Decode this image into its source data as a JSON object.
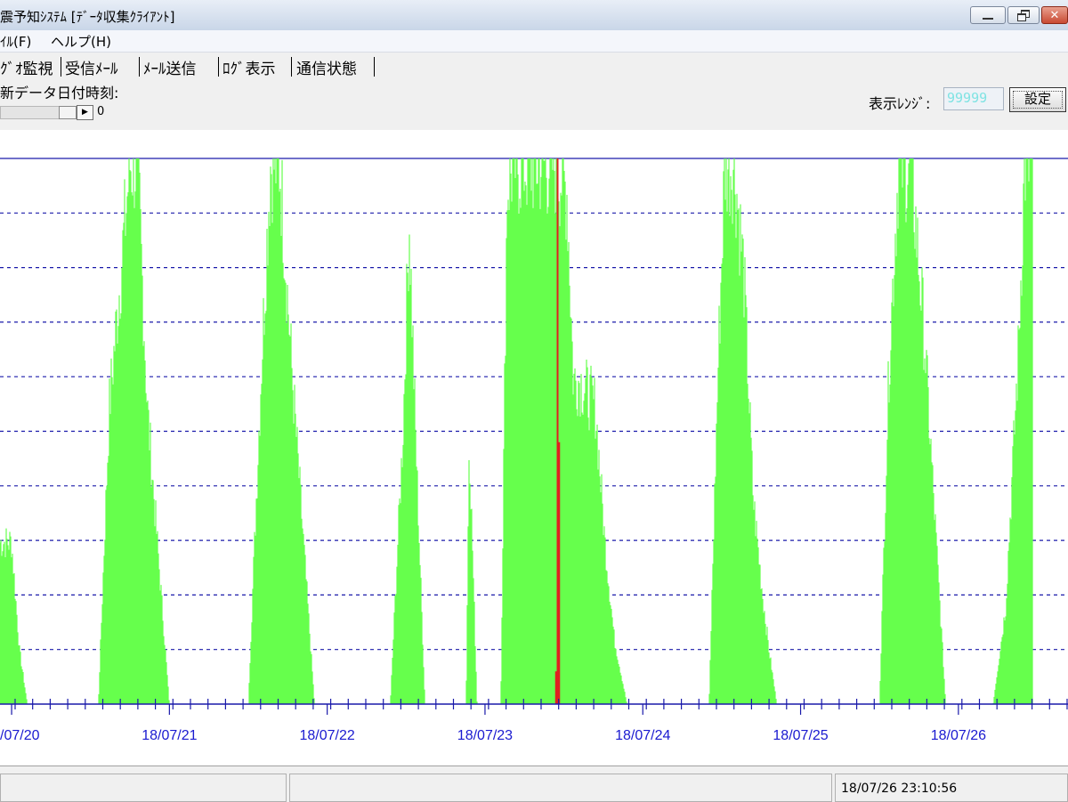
{
  "window": {
    "title": "震予知ｼｽﾃﾑ [ﾃﾞｰﾀ収集ｸﾗｲｱﾝﾄ]",
    "minimize_icon": "minimize-icon",
    "restore_icon": "restore-icon",
    "close_icon": "close-icon"
  },
  "menu": {
    "items": [
      "ｲﾙ(F)",
      "ヘルプ(H)"
    ]
  },
  "tabs": [
    "ｸﾞｵ監視",
    "受信ﾒｰﾙ",
    "ﾒｰﾙ送信",
    "ﾛｸﾞ表示",
    "通信状態"
  ],
  "toolbar": {
    "date_label": "新データ日付時刻:",
    "slider_value": "0",
    "range_label": "表示ﾚﾝｼﾞ:",
    "range_value": "99999",
    "set_button": "設定"
  },
  "status": {
    "datetime": "18/07/26 23:10:56"
  },
  "colors": {
    "bar_green": "#66ff4d",
    "event_red": "#e02020",
    "grid_blue": "#1a1aaa",
    "axis_label": "#1a1ad0"
  },
  "chart_data": {
    "type": "area",
    "x_tick_labels": [
      "/07/20",
      "18/07/21",
      "18/07/22",
      "18/07/23",
      "18/07/24",
      "18/07/25",
      "18/07/26"
    ],
    "x_unit": "days since first visible day (18/07/20)",
    "ylim": [
      0,
      100
    ],
    "y_unit": "percent of display range",
    "grid": true,
    "gridline_count": 10,
    "series": [
      {
        "name": "green",
        "x": [
          0.0,
          0.05,
          0.1,
          0.55,
          0.62,
          0.75,
          0.8,
          0.86,
          1.0,
          1.1,
          1.5,
          1.58,
          1.64,
          1.7,
          1.78,
          1.92,
          2.05,
          2.1,
          2.4,
          2.48,
          2.52,
          2.56,
          2.62,
          2.88,
          2.9,
          2.95,
          3.1,
          3.14,
          3.18,
          3.45,
          3.52,
          3.56,
          3.6,
          3.7,
          3.76,
          3.82,
          3.9,
          4.0,
          4.05,
          4.42,
          4.48,
          4.52,
          4.58,
          4.64,
          4.7,
          4.76,
          4.8,
          4.85,
          4.88,
          4.92,
          5.44,
          5.5,
          5.56,
          5.62,
          5.7,
          5.78,
          5.84,
          5.88,
          5.92,
          6.0
        ],
        "values": [
          30,
          10,
          0,
          0,
          55,
          100,
          100,
          55,
          0,
          0,
          0,
          60,
          100,
          100,
          60,
          0,
          0,
          0,
          0,
          50,
          90,
          50,
          0,
          0,
          50,
          0,
          0,
          96,
          100,
          100,
          95,
          60,
          60,
          55,
          30,
          12,
          0,
          0,
          0,
          0,
          65,
          100,
          100,
          80,
          38,
          20,
          10,
          0,
          0,
          0,
          0,
          0,
          62,
          100,
          100,
          70,
          40,
          20,
          0,
          0
        ],
        "last_day_values_x": [
          6.0,
          6.22,
          6.3,
          6.38,
          6.42,
          6.47
        ],
        "last_day_values_y": [
          0,
          0,
          18,
          65,
          100,
          100
        ]
      },
      {
        "name": "red",
        "x": [
          3.44,
          3.45,
          3.46,
          3.47,
          3.48
        ],
        "values": [
          0,
          6,
          100,
          48,
          0
        ]
      }
    ]
  }
}
